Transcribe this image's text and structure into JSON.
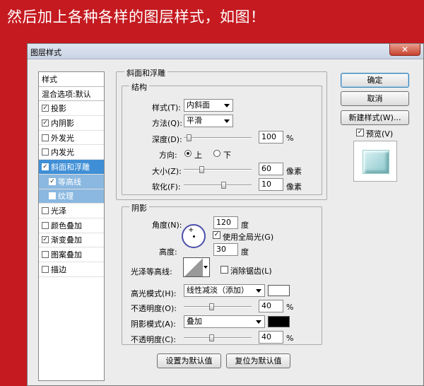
{
  "banner": "然后加上各种各样的图层样式，如图！",
  "window": {
    "title": "图层样式",
    "close": "✕"
  },
  "left_list": {
    "header": "样式",
    "blending": "混合选项:默认",
    "items": [
      {
        "label": "投影",
        "checked": true
      },
      {
        "label": "内阴影",
        "checked": true
      },
      {
        "label": "外发光",
        "checked": false
      },
      {
        "label": "内发光",
        "checked": false
      },
      {
        "label": "斜面和浮雕",
        "checked": true,
        "selected": true
      },
      {
        "label": "等高线",
        "checked": true,
        "sub": true
      },
      {
        "label": "纹理",
        "checked": false,
        "sub": true
      },
      {
        "label": "光泽",
        "checked": false
      },
      {
        "label": "颜色叠加",
        "checked": false
      },
      {
        "label": "渐变叠加",
        "checked": true
      },
      {
        "label": "图案叠加",
        "checked": false
      },
      {
        "label": "描边",
        "checked": false
      }
    ]
  },
  "bevel": {
    "group_title": "斜面和浮雕",
    "structure_title": "结构",
    "style_label": "样式(T):",
    "style_value": "内斜面",
    "technique_label": "方法(Q):",
    "technique_value": "平滑",
    "depth_label": "深度(D):",
    "depth_value": "100",
    "depth_unit": "%",
    "depth_level": 0.05,
    "direction_label": "方向:",
    "dir_up": "上",
    "dir_down": "下",
    "size_label": "大小(Z):",
    "size_value": "60",
    "size_unit": "像素",
    "size_level": 0.25,
    "soften_label": "软化(F):",
    "soften_value": "10",
    "soften_unit": "像素",
    "soften_level": 0.6
  },
  "shading": {
    "title": "阴影",
    "angle_label": "角度(N):",
    "angle_value": "120",
    "angle_unit": "度",
    "global_light": "使用全局光(G)",
    "altitude_label": "高度:",
    "altitude_value": "30",
    "altitude_unit": "度",
    "gloss_label": "光泽等高线:",
    "antialias": "消除锯齿(L)",
    "highlight_label": "高光模式(H):",
    "highlight_value": "线性减淡（添加）",
    "highlight_color": "#ffffff",
    "hl_opacity_label": "不透明度(O):",
    "hl_opacity_value": "40",
    "hl_opacity_unit": "%",
    "hl_opacity_level": 0.4,
    "shadow_label": "阴影模式(A):",
    "shadow_value": "叠加",
    "shadow_color": "#000000",
    "sh_opacity_label": "不透明度(C):",
    "sh_opacity_value": "40",
    "sh_opacity_unit": "%",
    "sh_opacity_level": 0.4
  },
  "footer": {
    "make_default": "设置为默认值",
    "reset_default": "复位为默认值"
  },
  "right": {
    "ok": "确定",
    "cancel": "取消",
    "new_style": "新建样式(W)...",
    "preview": "预览(V)"
  }
}
